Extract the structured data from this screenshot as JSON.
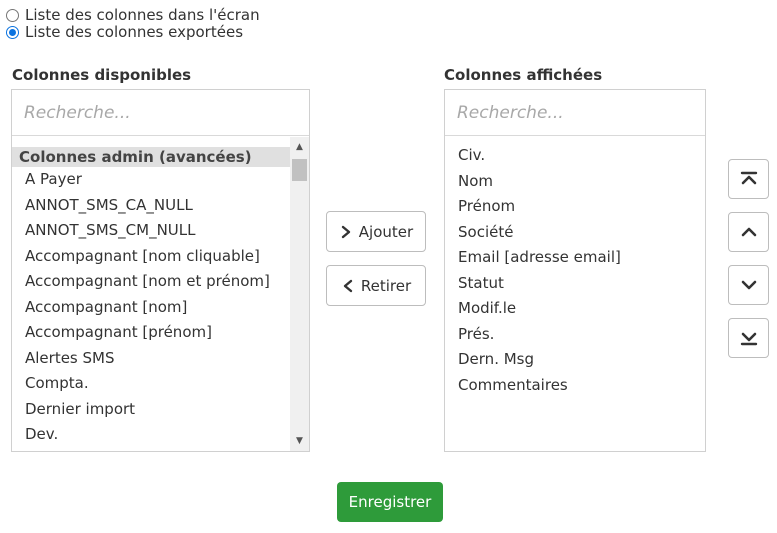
{
  "view_options": [
    {
      "label": "Liste des colonnes dans l'écran",
      "checked": false
    },
    {
      "label": "Liste des colonnes exportées",
      "checked": true
    }
  ],
  "available": {
    "title": "Colonnes disponibles",
    "search_placeholder": "Recherche...",
    "group_header": "Colonnes admin (avancées)",
    "items": [
      "A Payer",
      "ANNOT_SMS_CA_NULL",
      "ANNOT_SMS_CM_NULL",
      "Accompagnant [nom cliquable]",
      "Accompagnant [nom et prénom]",
      "Accompagnant [nom]",
      "Accompagnant [prénom]",
      "Alertes SMS",
      "Compta.",
      "Dernier import",
      "Dev."
    ]
  },
  "displayed": {
    "title": "Colonnes affichées",
    "search_placeholder": "Recherche...",
    "items": [
      "Civ.",
      "Nom",
      "Prénom",
      "Société",
      "Email [adresse email]",
      "Statut",
      "Modif.le",
      "Prés.",
      "Dern. Msg",
      "Commentaires"
    ]
  },
  "actions": {
    "add_label": "Ajouter",
    "remove_label": "Retirer",
    "save_label": "Enregistrer"
  },
  "colors": {
    "save_button": "#2e9b3a",
    "radio_accent": "#0b73e0"
  }
}
